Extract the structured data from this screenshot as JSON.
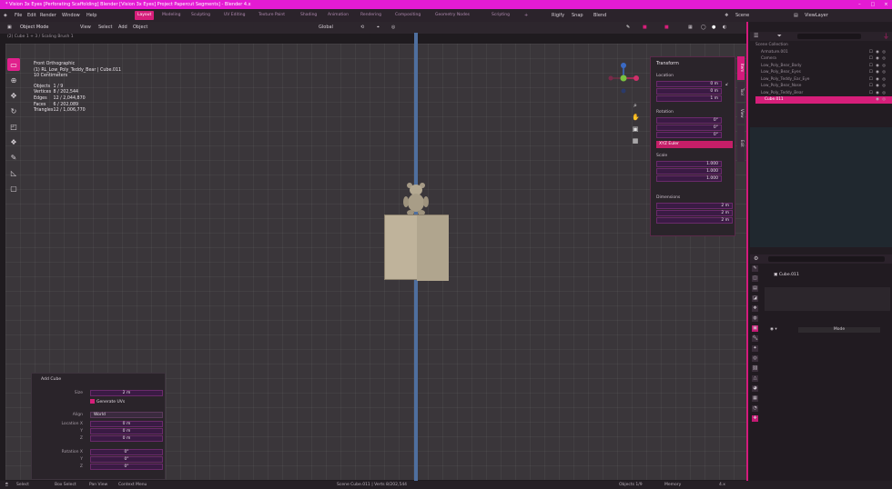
{
  "window": {
    "title": "* Vision 3x Eyes [Perforating Scaffolding] Blender [Vision 3x Eyes] Project Papercut Segments] - Blender 4.x",
    "controls": [
      "–",
      "□",
      "×"
    ]
  },
  "menubar": {
    "menus": [
      "File",
      "Edit",
      "Render",
      "Window",
      "Help"
    ],
    "workspaces": [
      "Layout",
      "Modeling",
      "Sculpting",
      "UV Editing",
      "Texture Paint",
      "Shading",
      "Animation",
      "Rendering",
      "Compositing",
      "Geometry Nodes",
      "Scripting"
    ],
    "active_workspace": "Layout",
    "scene_label": "Scene",
    "view_layer_label": "ViewLayer",
    "right_items": [
      "Rigify",
      "Snap",
      "Blend"
    ]
  },
  "viewport_header": {
    "mode": "Object Mode",
    "menus": [
      "View",
      "Select",
      "Add",
      "Object"
    ],
    "transform": "Global",
    "breadcrumb": "(2) Cube 1 + 3 / Scaling Brush 1"
  },
  "stats": {
    "view": "Front Orthographic",
    "collection": "(1) RL_Low_Poly_Teddy_Bear | Cube.011",
    "units": "10 Centimeters",
    "rows": [
      {
        "k": "Objects",
        "v": "1 / 9"
      },
      {
        "k": "Vertices",
        "v": "8 / 202,544"
      },
      {
        "k": "Edges",
        "v": "12 / 2,044,870"
      },
      {
        "k": "Faces",
        "v": "6 / 202,089"
      },
      {
        "k": "Triangles",
        "v": "12 / 1,006,770"
      }
    ]
  },
  "n_panel": {
    "title": "Transform",
    "location_label": "Location",
    "location": [
      {
        "a": "X",
        "v": "0 m"
      },
      {
        "a": "Y",
        "v": "0 m"
      },
      {
        "a": "Z",
        "v": "1 m"
      }
    ],
    "rotation_label": "Rotation",
    "rotation": [
      {
        "a": "X",
        "v": "0°"
      },
      {
        "a": "Y",
        "v": "0°"
      },
      {
        "a": "Z",
        "v": "0°"
      }
    ],
    "rotation_mode": "XYZ Euler",
    "scale_label": "Scale",
    "scale": [
      {
        "a": "X",
        "v": "1.000"
      },
      {
        "a": "Y",
        "v": "1.000"
      },
      {
        "a": "Z",
        "v": "1.000"
      }
    ],
    "dimensions_label": "Dimensions",
    "dimensions": [
      {
        "a": "X",
        "v": "2 m"
      },
      {
        "a": "Y",
        "v": "2 m"
      },
      {
        "a": "Z",
        "v": "2 m"
      }
    ],
    "tabs": [
      "Item",
      "Tool",
      "View",
      "Edit"
    ]
  },
  "tools": [
    "Select Box",
    "Cursor",
    "Move",
    "Rotate",
    "Scale",
    "Transform",
    "Annotate",
    "Measure",
    "Add Cube"
  ],
  "operator_panel": {
    "title": "Add Cube",
    "size_label": "Size",
    "size": "2 m",
    "generate_uvs": "Generate UVs",
    "align_label": "Align",
    "align": "World",
    "location_label": "Location X",
    "location": [
      "0 m",
      "0 m",
      "0 m"
    ],
    "rotation_label": "Rotation X",
    "rotation": [
      "0°",
      "0°",
      "0°"
    ],
    "axis_y": "Y",
    "axis_z": "Z"
  },
  "outliner": {
    "rows": [
      {
        "name": "Scene Collection",
        "sel": false
      },
      {
        "name": "Armature.001",
        "sel": false
      },
      {
        "name": "Camera",
        "sel": false
      },
      {
        "name": "Low_Poly_Bear_Body",
        "sel": false
      },
      {
        "name": "Low_Poly_Bear_Eyes",
        "sel": false
      },
      {
        "name": "Low_Poly_Teddy_Ear_Eye",
        "sel": false
      },
      {
        "name": "Low_Poly_Bear_Nose",
        "sel": false
      },
      {
        "name": "Low_Poly_Teddy_Bear",
        "sel": false
      },
      {
        "name": "Cube.011",
        "sel": true
      }
    ]
  },
  "properties": {
    "object_name": "Cube.011",
    "row_label": "Mode"
  },
  "status_bar": {
    "left": [
      "Select",
      "Box Select",
      "Pan View",
      "Context Menu"
    ],
    "center": "Scene  Cube.011  |  Verts 8/202,544",
    "right": [
      "Objects 1/9",
      "Memory",
      "4.x"
    ]
  },
  "colors": {
    "accent": "#d61e7a",
    "title_bar": "#e41bd3",
    "viewport": "#3a363a",
    "blade": "#4f6f9f"
  }
}
